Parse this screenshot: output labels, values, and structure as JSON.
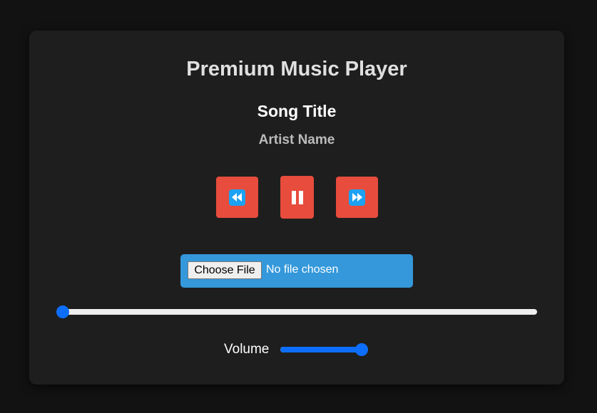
{
  "player": {
    "app_title": "Premium Music Player",
    "song_title": "Song Title",
    "artist_name": "Artist Name"
  },
  "controls": {
    "prev_icon": "rewind-icon",
    "play_icon": "pause-icon",
    "next_icon": "fast-forward-icon"
  },
  "file_input": {
    "button_label": "Choose File",
    "status": "No file chosen"
  },
  "progress": {
    "value": 0
  },
  "volume": {
    "label": "Volume",
    "value": 1.0
  },
  "colors": {
    "background": "#121212",
    "card": "#1e1e1e",
    "button": "#e74c3c",
    "file_zone": "#3498db",
    "slider_accent": "#0d6efd"
  }
}
